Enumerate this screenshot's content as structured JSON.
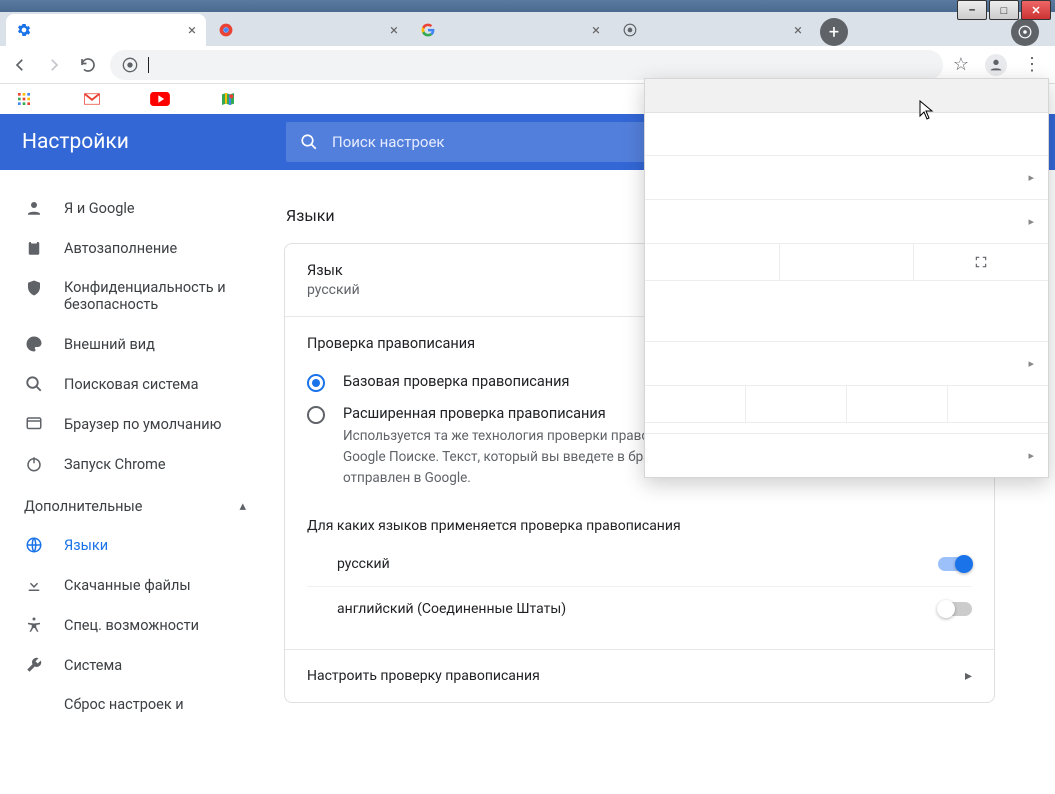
{
  "window": {
    "minimize": "–",
    "maximize": "□",
    "close": "✕"
  },
  "tabs": {
    "new_label": "+"
  },
  "omnibox": {
    "placeholder": ""
  },
  "settings": {
    "title": "Настройки",
    "search_placeholder": "Поиск настроек"
  },
  "sidebar": {
    "items": [
      {
        "label": "Я и Google"
      },
      {
        "label": "Автозаполнение"
      },
      {
        "label": "Конфиденциальность и безопасность"
      },
      {
        "label": "Внешний вид"
      },
      {
        "label": "Поисковая система"
      },
      {
        "label": "Браузер по умолчанию"
      },
      {
        "label": "Запуск Chrome"
      }
    ],
    "advanced_header": "Дополнительные",
    "advanced": [
      {
        "label": "Языки"
      },
      {
        "label": "Скачанные файлы"
      },
      {
        "label": "Спец. возможности"
      },
      {
        "label": "Система"
      },
      {
        "label": "Сброс настроек и"
      }
    ]
  },
  "content": {
    "section_title": "Языки",
    "language_label": "Язык",
    "language_value": "русский",
    "spellcheck_title": "Проверка правописания",
    "radio1": "Базовая проверка правописания",
    "radio2": "Расширенная проверка правописания",
    "radio2_desc": "Используется та же технология проверки правописания, что и в Google Поиске. Текст, который вы введете в браузере, будет отправлен в Google.",
    "apply_header": "Для каких языков применяется проверка правописания",
    "lang_rows": [
      {
        "label": "русский",
        "on": true
      },
      {
        "label": "английский (Соединенные Штаты)",
        "on": false
      }
    ],
    "customize": "Настроить проверку правописания"
  }
}
